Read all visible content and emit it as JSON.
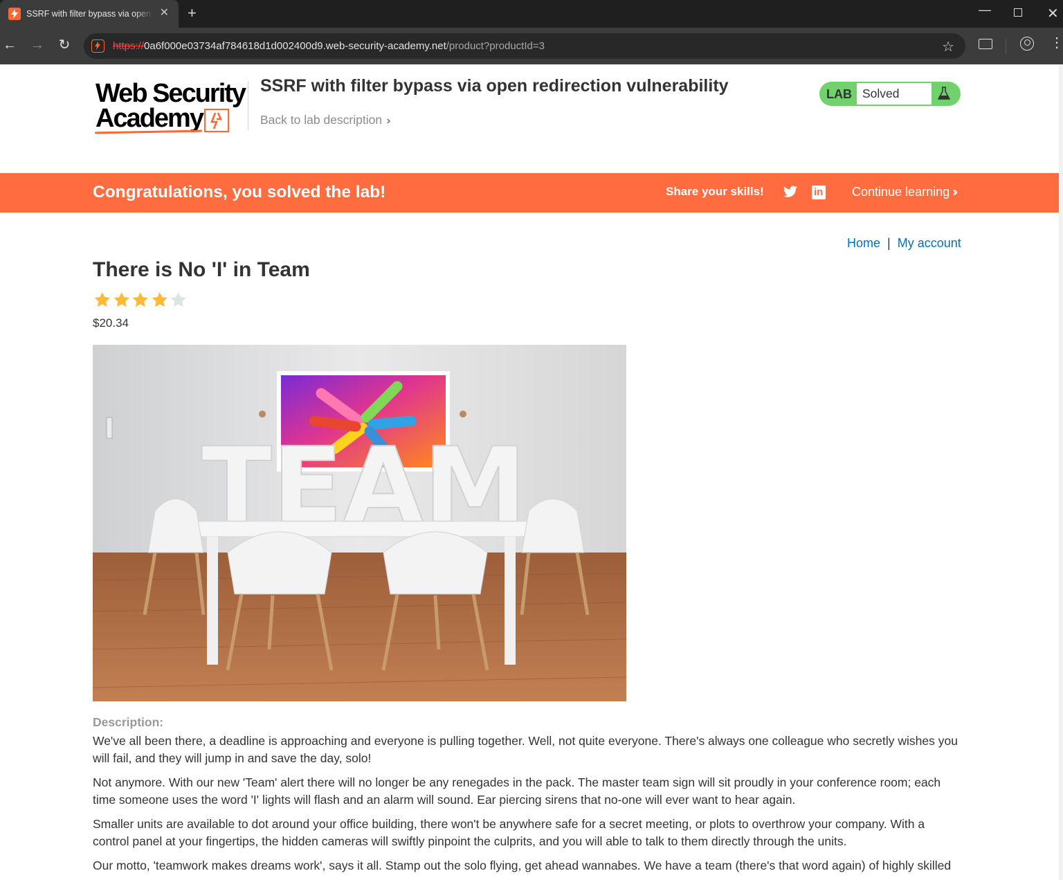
{
  "browser": {
    "tab_title": "SSRF with filter bypass via open redirection vulnerability",
    "new_tab": "+",
    "url_scheme": "https://",
    "url_host": "0a6f000e03734af784618d1d002400d9.web-security-academy.net",
    "url_path": "/product?productId=3"
  },
  "header": {
    "logo_line1": "Web Security",
    "logo_line2": "Academy",
    "lab_title": "SSRF with filter bypass via open redirection vulnerability",
    "back_link": "Back to lab description",
    "badge_label": "LAB",
    "badge_status": "Solved",
    "badge_color": "#70d16d"
  },
  "banner": {
    "message": "Congratulations, you solved the lab!",
    "share": "Share your skills!",
    "continue": "Continue learning",
    "color": "#ff6c3f"
  },
  "nav": {
    "home": "Home",
    "separator": "|",
    "account": "My account"
  },
  "product": {
    "title": "There is No 'I' in Team",
    "rating": 4,
    "rating_max": 5,
    "price": "$20.34",
    "image_text": "TEAM",
    "description_label": "Description:",
    "paragraphs": [
      "We've all been there, a deadline is approaching and everyone is pulling together. Well, not quite everyone. There's always one colleague who secretly wishes you will fail, and they will jump in and save the day, solo!",
      "Not anymore. With our new 'Team' alert there will no longer be any renegades in the pack. The master team sign will sit proudly in your conference room; each time someone uses the word 'I' lights will flash and an alarm will sound. Ear piercing sirens that no-one will ever want to hear again.",
      "Smaller units are available to dot around your office building, there won't be anywhere safe for a secret meeting, or plots to overthrow your company. With a control panel at your fingertips, the hidden cameras will swiftly pinpoint the culprits, and you will able to talk to them directly through the units.",
      "Our motto, 'teamwork makes dreams work', says it all. Stamp out the solo flying, get ahead wannabes. We have a team (there's that word again) of highly skilled"
    ]
  }
}
